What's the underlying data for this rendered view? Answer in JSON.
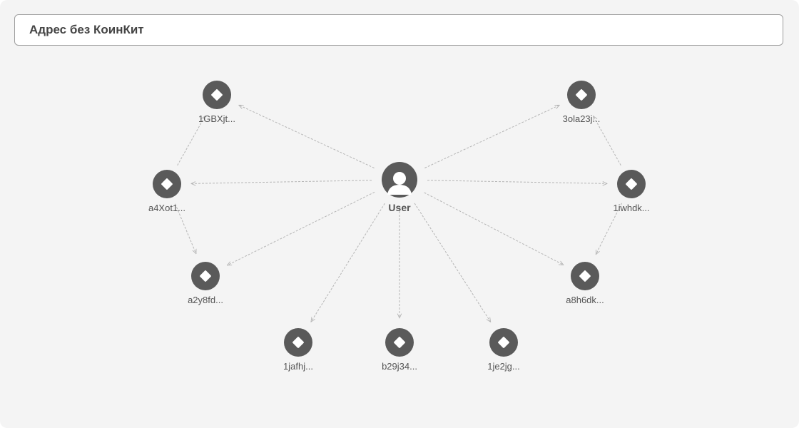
{
  "header": {
    "title": "Адрес без КоинКит"
  },
  "graph": {
    "center": {
      "label": "User",
      "icon": "user-avatar-icon"
    },
    "nodes": [
      {
        "id": "n1",
        "label": "1GBXjt..."
      },
      {
        "id": "n2",
        "label": "a4Xot1..."
      },
      {
        "id": "n3",
        "label": "a2y8fd..."
      },
      {
        "id": "n4",
        "label": "1jafhj..."
      },
      {
        "id": "n5",
        "label": "b29j34..."
      },
      {
        "id": "n6",
        "label": "1je2jg..."
      },
      {
        "id": "n7",
        "label": "a8h6dk..."
      },
      {
        "id": "n8",
        "label": "1iwhdk..."
      },
      {
        "id": "n9",
        "label": "3ola23j..."
      }
    ],
    "edges": [
      {
        "from": "user",
        "to": "n1"
      },
      {
        "from": "user",
        "to": "n2"
      },
      {
        "from": "user",
        "to": "n3"
      },
      {
        "from": "user",
        "to": "n4"
      },
      {
        "from": "user",
        "to": "n5"
      },
      {
        "from": "user",
        "to": "n6"
      },
      {
        "from": "user",
        "to": "n7"
      },
      {
        "from": "user",
        "to": "n8"
      },
      {
        "from": "user",
        "to": "n9"
      },
      {
        "from": "n2",
        "to": "n1"
      },
      {
        "from": "n2",
        "to": "n3"
      },
      {
        "from": "n8",
        "to": "n9"
      },
      {
        "from": "n8",
        "to": "n7"
      }
    ],
    "colors": {
      "node_fill": "#5a5a5a",
      "edge": "#b5b5b5",
      "icon_fill": "#ffffff"
    }
  }
}
